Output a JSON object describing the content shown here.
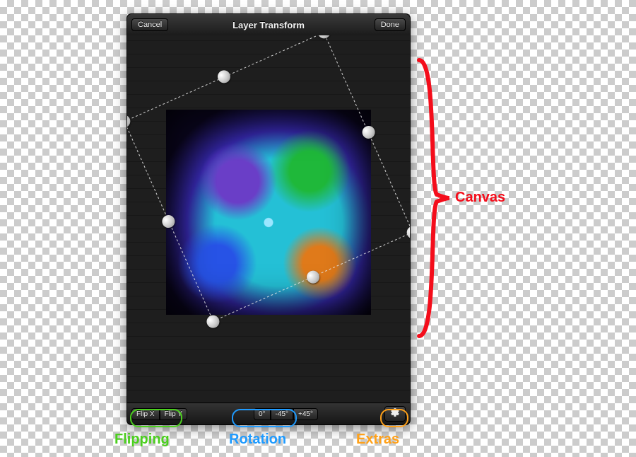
{
  "header": {
    "cancel": "Cancel",
    "title": "Layer Transform",
    "done": "Done"
  },
  "toolbar": {
    "flip_x": "Flip X",
    "flip_y": "Flip Y",
    "rot_0": "0°",
    "rot_m45": "-45°",
    "rot_p45": "+45°"
  },
  "annotations": {
    "canvas": "Canvas",
    "flipping": "Flipping",
    "rotation": "Rotation",
    "extras": "Extras"
  },
  "transform": {
    "rotation_deg": -24
  }
}
